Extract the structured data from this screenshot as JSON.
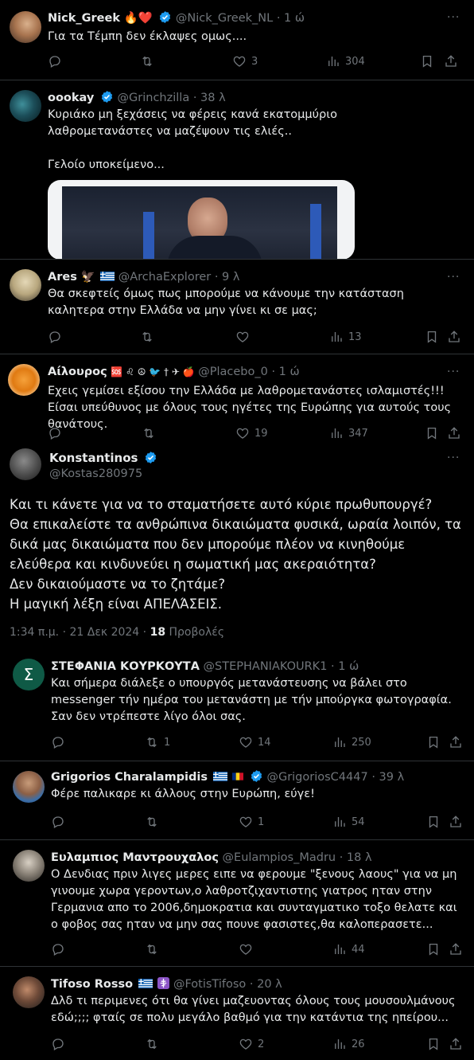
{
  "colors": {
    "background": "#000000",
    "text": "#e7e9ea",
    "muted": "#71767b",
    "verified": "#1d9bf0",
    "divider": "#2f3336"
  },
  "tweets": [
    {
      "name": "Nick_Greek",
      "name_emoji": "🔥❤️",
      "handle": "@Nick_Greek_NL",
      "time": "· 1 ώ",
      "text": "Για τα Τέμπη δεν έκλαψες ομως....",
      "likes": "3",
      "views": "304"
    },
    {
      "name": "oookay",
      "handle": "@Grinchzilla",
      "time": "· 38 λ",
      "text1": "Κυριάκο μη ξεχάσεις να φέρεις κανά εκατομμύριο λαθρομετανάστες να μαζέψουν τις ελιές..",
      "text2": "Γελοίο υποκείμενο..."
    },
    {
      "name": "Ares",
      "name_emoji": "🦅",
      "handle": "@ArchaExplorer",
      "time": "· 9 λ",
      "text": "Θα σκεφτείς όμως πως μπορούμε να κάνουμε την κατάσταση καλητερα στην Ελλάδα να μην γίνει κι σε μας;",
      "views": "13"
    },
    {
      "name": "Αίλουρος",
      "name_emoji": "🆘 ♌ ☮ 🐦 † ✈ 🍎",
      "handle": "@Placebo_0",
      "time": "· 1 ώ",
      "text": "Εχεις  γεμίσει εξίσου την Ελλάδα με λαθρομετανάστες ισλαμιστές!!! Είσαι υπεύθυνος με όλους τους ηγέτες της Ευρώπης για αυτούς τους θανάτους.",
      "likes": "19",
      "views": "347"
    }
  ],
  "main": {
    "name": "Konstantinos",
    "handle": "@Kostas280975",
    "lines": [
      "Και τι κάνετε για να το σταματήσετε αυτό κύριε πρωθυπουργέ?",
      "Θα επικαλείστε τα ανθρώπινα δικαιώματα φυσικά, ωραία λοιπόν, τα δικά μας δικαιώματα που δεν μπορούμε πλέον να κινηθούμε ελεύθερα και κινδυνεύει η σωματική μας ακεραιότητα?",
      "Δεν δικαιούμαστε να το ζητάμε?",
      "Η μαγική λέξη είναι ΑΠΕΛΆΣΕΙΣ."
    ],
    "time": "1:34 π.μ. · 21 Δεκ 2024 ·",
    "views_count": "18",
    "views_label": "Προβολές"
  },
  "replies": [
    {
      "name": "ΣΤΕΦΑΝΙΑ ΚΟΥΡΚΟΥΤΑ",
      "handle": "@STEPHANIAKOURK1",
      "time": "· 1 ώ",
      "avatar_letter": "Σ",
      "text": "Και σήμερα διάλεξε ο υπουργός μετανάστευσης να βάλει στο messenger τήν ημέρα του μετανάστη με τήν μπούργκα φωτογραφία. Σαν δεν ντρέπεστε λίγο όλοι σας.",
      "retweets": "1",
      "likes": "14",
      "views": "250"
    },
    {
      "name": "Grigorios Charalampidis",
      "handle": "@GrigoriosC4447",
      "time": "· 39 λ",
      "text": "Φέρε παλικαρε κι άλλους στην Ευρώπη, εύγε!",
      "likes": "1",
      "views": "54"
    },
    {
      "name": "Ευλαμπιος Μαντρουχαλος",
      "handle": "@Eulampios_Madru",
      "time": "· 18 λ",
      "text": "Ο Δενδιας πριν λιγες μερες ειπε να φερουμε \"ξενους λαους\" για να μη γινουμε χωρα γεροντων,ο λαθροτζιχαντιστης γιατρος ηταν στην Γερμανια απο το 2006,δημοκρατια και συνταγματικο τοξο θελατε και ο φοβος σας ηταν να μην σας πουνε φασιστες,θα καλοπερασετε...",
      "views": "44"
    },
    {
      "name": "Tifoso Rosso",
      "handle": "@FotisTifoso",
      "time": "· 20 λ",
      "text": "Δλδ τι περιμενες ότι θα γίνει μαζευοντας όλους τους μουσουλμάνους εδώ;;;; φταίς σε πολυ μεγάλο βαθμό για την κατάντια της ηπείρου...",
      "likes": "2",
      "views": "26"
    }
  ]
}
